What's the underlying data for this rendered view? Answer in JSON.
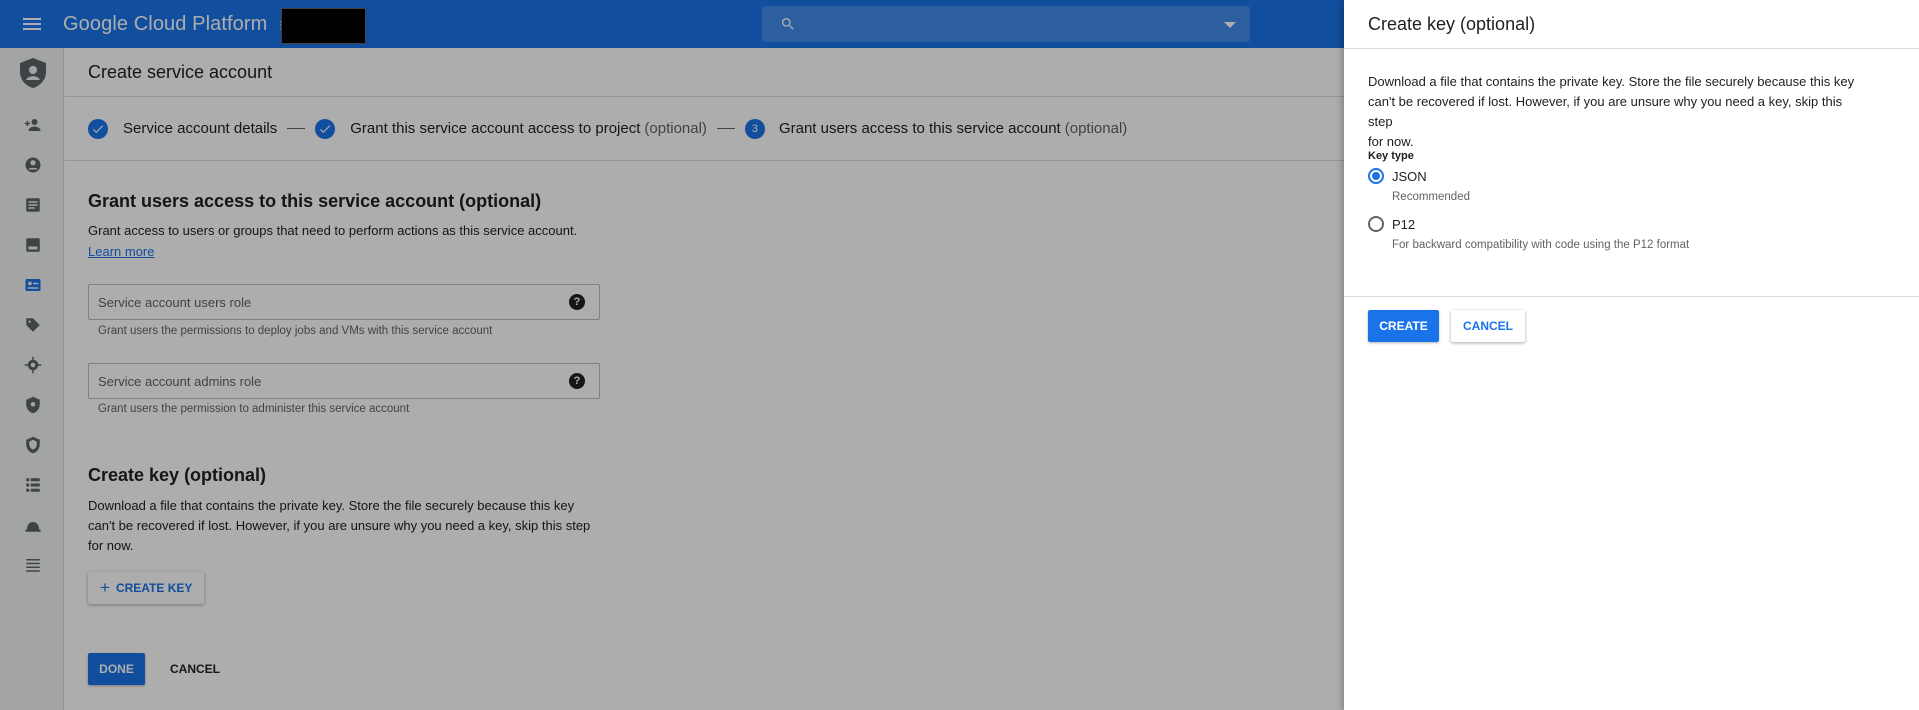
{
  "topbar": {
    "app_name": "Google Cloud Platform",
    "project_indicator": "⁝",
    "search_placeholder": ""
  },
  "page": {
    "title": "Create service account"
  },
  "stepper": {
    "steps": [
      {
        "label": "Service account details",
        "optional": "",
        "state": "done"
      },
      {
        "label": "Grant this service account access to project",
        "optional": "(optional)",
        "state": "done"
      },
      {
        "label": "Grant users access to this service account",
        "optional": "(optional)",
        "state": "active",
        "number": "3"
      }
    ]
  },
  "grant_users": {
    "title": "Grant users access to this service account (optional)",
    "description": "Grant access to users or groups that need to perform actions as this service account.",
    "learn_more": "Learn more",
    "users_role_placeholder": "Service account users role",
    "users_role_hint": "Grant users the permissions to deploy jobs and VMs with this service account",
    "admins_role_placeholder": "Service account admins role",
    "admins_role_hint": "Grant users the permission to administer this service account",
    "help_glyph": "?"
  },
  "create_key_section": {
    "title": "Create key (optional)",
    "description_line1": "Download a file that contains the private key. Store the file securely because this key",
    "description_line2": "can't be recovered if lost. However, if you are unsure why you need a key, skip this step",
    "description_line3": "for now.",
    "button_label": "CREATE KEY",
    "button_icon": "+"
  },
  "footer": {
    "done_label": "DONE",
    "cancel_label": "CANCEL"
  },
  "panel": {
    "title": "Create key (optional)",
    "description_line1": "Download a file that contains the private key. Store the file securely because this key",
    "description_line2": "can't be recovered if lost. However, if you are unsure why you need a key, skip this step",
    "description_line3": "for now.",
    "key_type_label": "Key type",
    "options": [
      {
        "label": "JSON",
        "sub": "Recommended",
        "selected": true
      },
      {
        "label": "P12",
        "sub": "For backward compatibility with code using the P12 format",
        "selected": false
      }
    ],
    "create_label": "CREATE",
    "cancel_label": "CANCEL"
  },
  "colors": {
    "brand_blue": "#1a73e8",
    "scrim": "rgba(0,0,0,0.32)"
  },
  "rail_icons": [
    "iam-shield-logo",
    "add-person-icon",
    "account-circle-icon",
    "article-icon",
    "storage-icon",
    "service-accounts-icon",
    "label-icon",
    "gear-icon",
    "security-shield-icon",
    "verified-shield-icon",
    "grid-list-icon",
    "admin-icon",
    "list-icon"
  ]
}
